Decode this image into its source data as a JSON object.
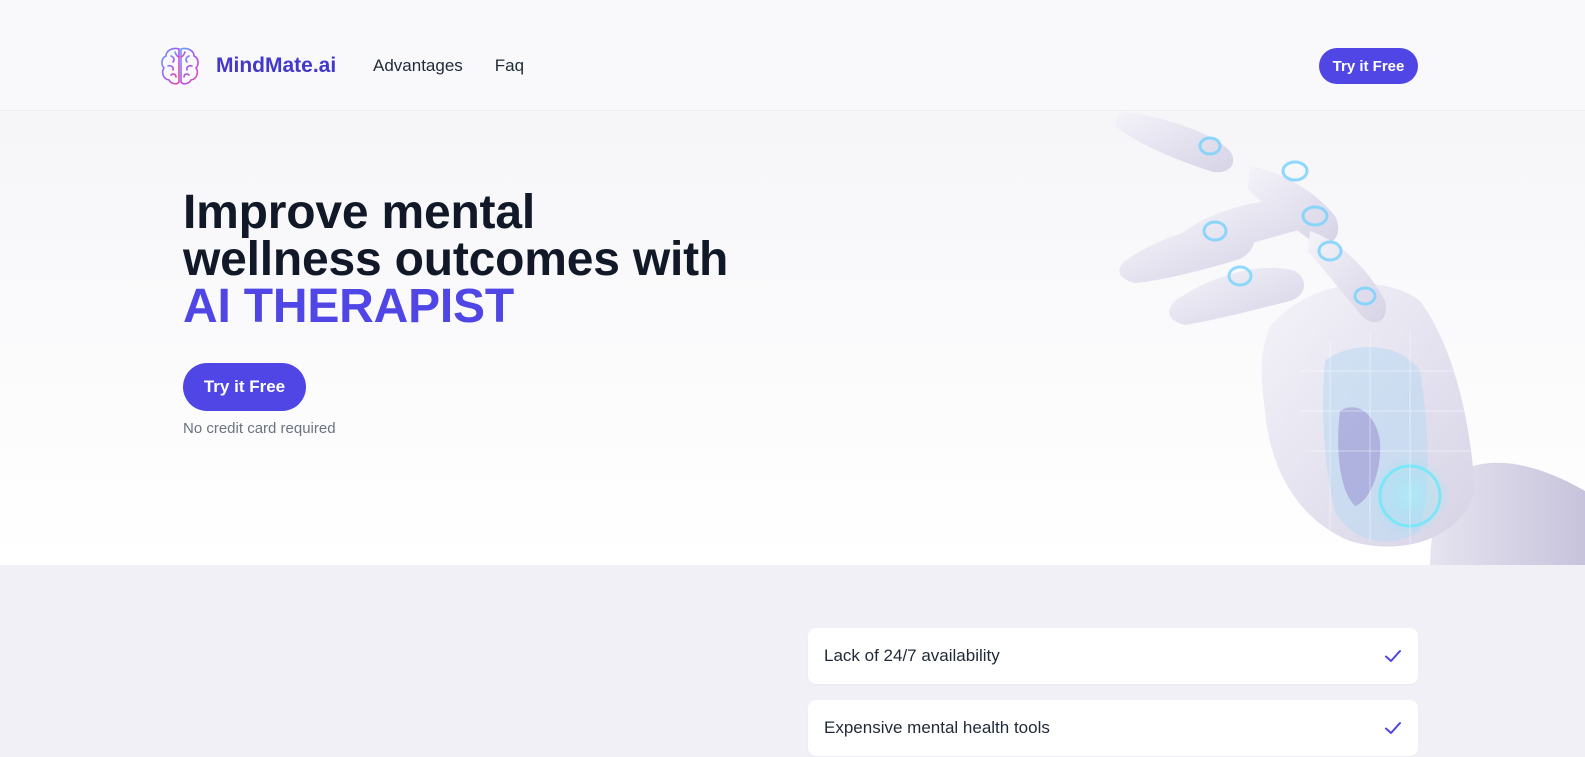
{
  "brand": {
    "name": "MindMate.ai",
    "logo_icon": "brain-icon"
  },
  "nav": {
    "items": [
      {
        "label": "Advantages"
      },
      {
        "label": "Faq"
      }
    ]
  },
  "header": {
    "cta_label": "Try it Free"
  },
  "hero": {
    "title_line1": "Improve mental",
    "title_line2": "wellness outcomes with",
    "title_accent": "AI THERAPIST",
    "cta_label": "Try it Free",
    "note": "No credit card required",
    "image_icon": "robot-hand-illustration"
  },
  "features": {
    "items": [
      {
        "label": "Lack of 24/7 availability",
        "icon": "check-icon"
      },
      {
        "label": "Expensive mental health tools",
        "icon": "check-icon"
      }
    ]
  },
  "colors": {
    "accent": "#4f46e5",
    "brand_text": "#4338ca",
    "heading": "#111827",
    "section_bg": "#f2f0f7"
  }
}
